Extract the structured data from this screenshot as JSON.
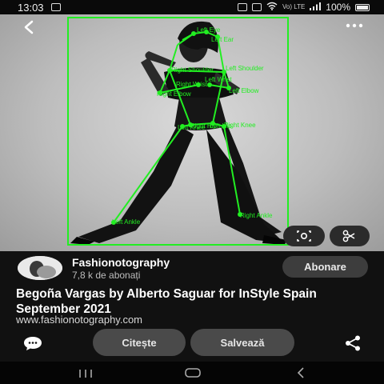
{
  "status_bar": {
    "time": "13:03",
    "network_label": "Vo) LTE",
    "battery": "100%"
  },
  "overlay": {
    "keypoint_labels": [
      "Left Eye",
      "Left Ear",
      "Right Shoulder",
      "Left Shoulder",
      "Right Elbow",
      "Left Elbow",
      "Right Wrist",
      "Left Wrist",
      "Right Hip",
      "Left Hip",
      "Left Knee",
      "Right Knee",
      "Left Ankle",
      "Right Ankle"
    ],
    "color": "#22ee22"
  },
  "post": {
    "channel_name": "Fashionotography",
    "subscribers": "7,8 k de abonați",
    "subscribe_label": "Abonare",
    "title": "Begoña Vargas by Alberto Saguar for InStyle Spain September 2021",
    "url": "www.fashionotography.com"
  },
  "actions": {
    "read_label": "Citește",
    "save_label": "Salvează"
  },
  "icons": {
    "back": "chevron-left-icon",
    "more": "more-horizontal-icon",
    "lens": "visual-search-icon",
    "crop": "scissors-icon",
    "comment": "comment-icon",
    "share": "share-icon"
  }
}
